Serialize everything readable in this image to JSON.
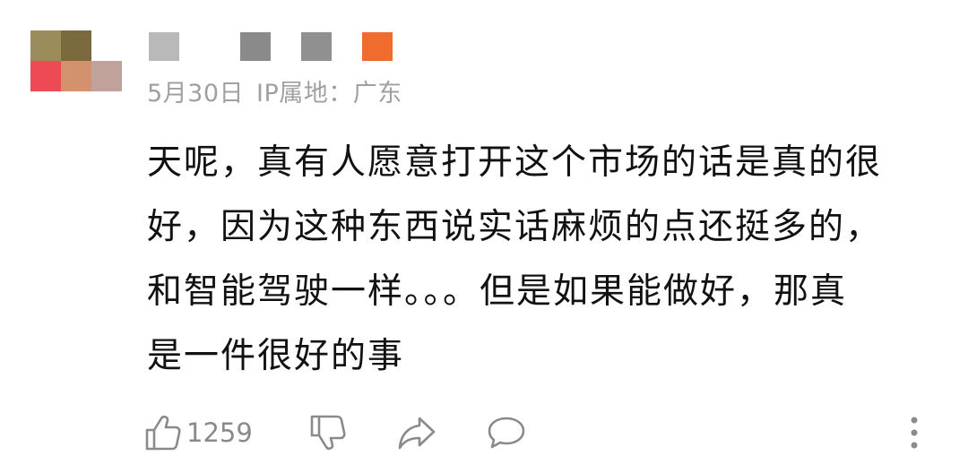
{
  "comment": {
    "avatar": {
      "pixels": [
        "#9c8c5a",
        "#7a6a3e",
        "#ffffff",
        "#ee4a55",
        "#d3926e",
        "#c0a29b"
      ]
    },
    "username": {
      "pixels": [
        "#b9b9b9",
        "#ffffff",
        "#8a8a8a",
        "#909090",
        "#ef6c2e"
      ]
    },
    "date": "5月30日",
    "ip_label": "IP属地：广东",
    "text_lines": [
      "天呢，真有人愿意打开这个市场的话是真的很",
      "好，因为这种东西说实话麻烦的点还挺多的，",
      "和智能驾驶一样。。。但是如果能做好，那真",
      "是一件很好的事"
    ],
    "actions": {
      "like_count": "1259",
      "icons": [
        "thumbs-up-icon",
        "thumbs-down-icon",
        "share-icon",
        "reply-icon",
        "more-icon"
      ]
    }
  }
}
